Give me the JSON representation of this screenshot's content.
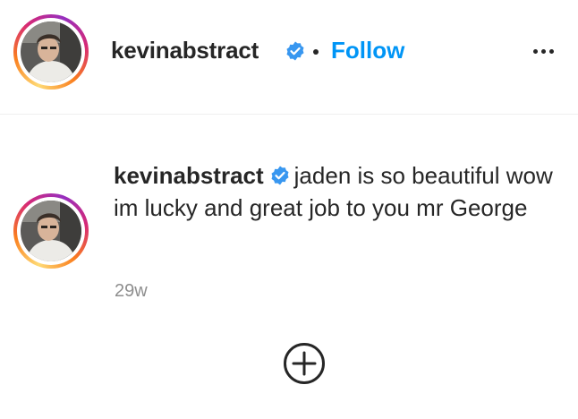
{
  "post_header": {
    "username": "kevinabstract",
    "follow_label": "Follow"
  },
  "comment": {
    "username": "kevinabstract",
    "text": "jaden is so beautiful wow im lucky and great job to you mr George",
    "timestamp": "29w"
  },
  "icons": {
    "verified": "verified-badge-icon",
    "more": "more-options-icon",
    "add": "add-circle-icon"
  },
  "colors": {
    "accent": "#0095f6",
    "text": "#262626",
    "muted": "#8e8e8e",
    "divider": "#efefef"
  }
}
